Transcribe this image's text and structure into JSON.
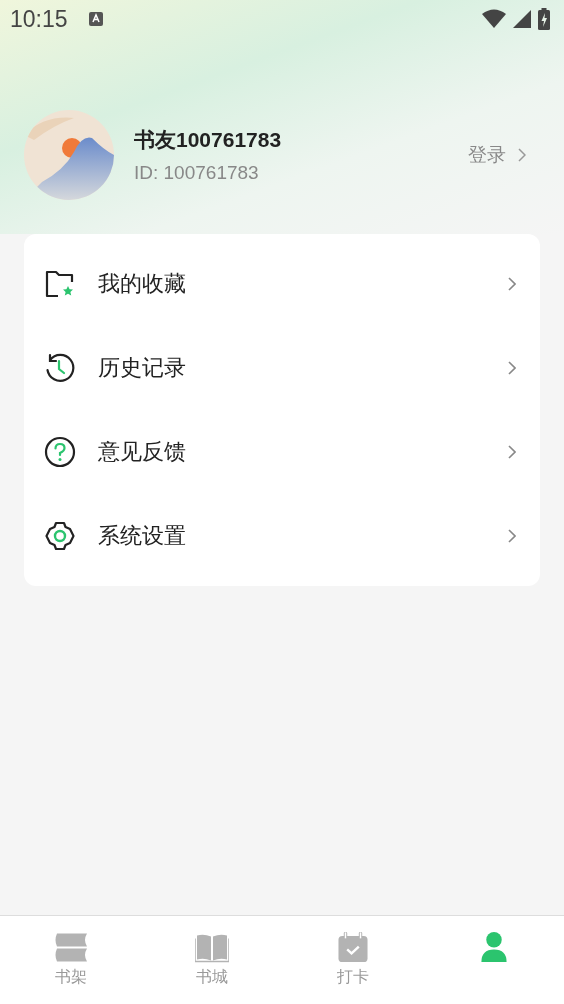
{
  "status_bar": {
    "time": "10:15"
  },
  "profile": {
    "name": "书友100761783",
    "id": "ID: 100761783",
    "login": "登录"
  },
  "menu": [
    {
      "kind": "favorites",
      "label": "我的收藏"
    },
    {
      "kind": "history",
      "label": "历史记录"
    },
    {
      "kind": "feedback",
      "label": "意见反馈"
    },
    {
      "kind": "settings",
      "label": "系统设置"
    }
  ],
  "tabs": [
    {
      "kind": "shelf",
      "label": "书架",
      "selected": false
    },
    {
      "kind": "store",
      "label": "书城",
      "selected": false
    },
    {
      "kind": "checkin",
      "label": "打卡",
      "selected": false
    },
    {
      "kind": "me",
      "selected": true
    }
  ]
}
